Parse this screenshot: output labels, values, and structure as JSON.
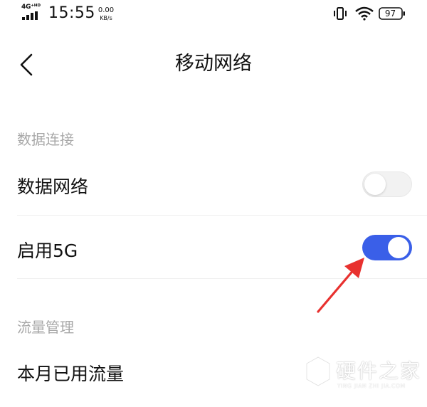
{
  "status_bar": {
    "network_type": "4G⁺ᴴᴰ",
    "time": "15:55",
    "speed_value": "0.00",
    "speed_unit": "KB/s",
    "battery_level": "97",
    "icons": [
      "signal-icon",
      "vibrate-icon",
      "wifi-icon",
      "battery-icon"
    ]
  },
  "header": {
    "title": "移动网络",
    "back_icon": "back-arrow-icon"
  },
  "sections": {
    "data_connection": {
      "label": "数据连接",
      "items": {
        "data_network": {
          "label": "数据网络",
          "enabled": false
        },
        "enable_5g": {
          "label": "启用5G",
          "enabled": true
        }
      }
    },
    "traffic_management": {
      "label": "流量管理",
      "items": {
        "monthly_usage": {
          "label": "本月已用流量"
        }
      }
    }
  },
  "annotation": {
    "icon": "red-pointer-arrow-icon",
    "color": "#e8312f"
  },
  "colors": {
    "toggle_on": "#3a5fe8",
    "toggle_off": "#f2f2f2",
    "section_label": "#a8a8a8"
  },
  "watermark": {
    "title": "硬件之家",
    "subtitle": "YING JIAN ZHI JIA.COM",
    "icon": "hexagon-logo-icon"
  }
}
